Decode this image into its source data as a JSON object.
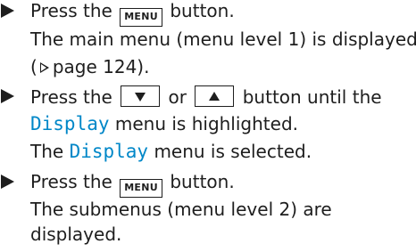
{
  "steps": [
    {
      "text_before_key": "Press the",
      "key_label": "MENU",
      "text_after_key": "button.",
      "result_line1": "The main menu (menu level 1) is displayed",
      "result_ref_open": "(",
      "result_ref_page": "page 124).",
      "pageref_icon": "page-reference-icon"
    },
    {
      "text_press": "Press the",
      "key_down_icon": "down-arrow-icon",
      "text_or": "or",
      "key_up_icon": "up-arrow-icon",
      "text_until": "button until the",
      "menu_name": "Display",
      "text_highlighted": "menu is highlighted.",
      "result_the": "The",
      "result_menu_name": "Display",
      "result_rest": "menu is selected."
    },
    {
      "text_before_key": "Press the",
      "key_label": "MENU",
      "text_after_key": "button.",
      "result_line1": "The submenus (menu level 2) are",
      "result_line2": "displayed."
    }
  ],
  "colors": {
    "text": "#1e1e1e",
    "menu_name": "#0087c8"
  }
}
